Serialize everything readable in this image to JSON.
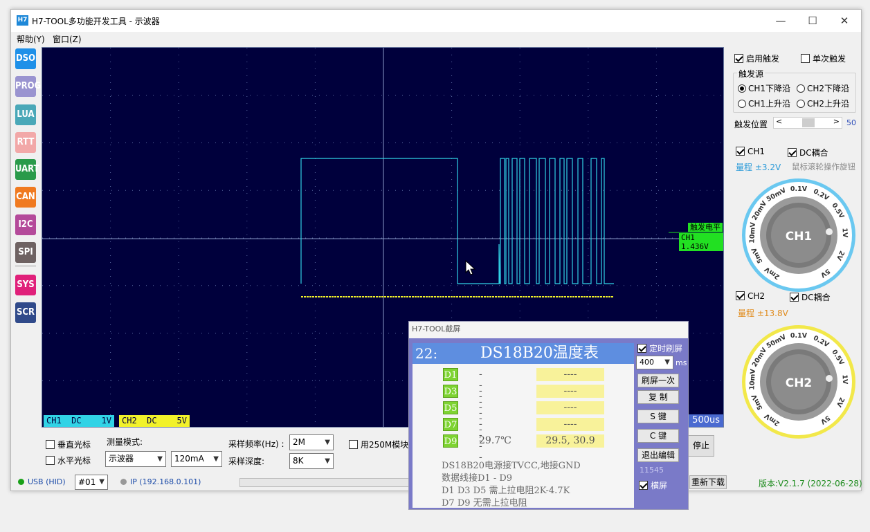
{
  "window": {
    "icon": "H7",
    "title": "H7-TOOL多功能开发工具 - 示波器",
    "minimize": "—",
    "maximize": "☐",
    "close": "✕"
  },
  "menu": {
    "help": "帮助(Y)",
    "window": "窗口(Z)"
  },
  "sidebar": {
    "items": [
      {
        "label": "DSO",
        "color": "#1e90e8"
      },
      {
        "label": "PROG",
        "color": "#9a94d0"
      },
      {
        "label": "LUA",
        "color": "#4aa8b8"
      },
      {
        "label": "RTT",
        "color": "#f2a8a8"
      },
      {
        "label": "UART",
        "color": "#2a9a4a"
      },
      {
        "label": "CAN",
        "color": "#f07a20"
      },
      {
        "label": "I2C",
        "color": "#b44a9a"
      },
      {
        "label": "SPI",
        "color": "#6e6262"
      },
      {
        "label": "SYS",
        "color": "#e0207a"
      },
      {
        "label": "SCR",
        "color": "#304a8a"
      }
    ]
  },
  "scope": {
    "trigger_level_label": "触发电平",
    "trigger_value_label": "CH1 1.436V",
    "ch1_label": "CH1  DC    1V",
    "ch2_label": "CH2  DC    5V",
    "timebase": "500us",
    "colors": {
      "ch1": "#31d3e6",
      "ch2": "#f2f22a",
      "bg": "#00003c",
      "trigger": "#22e022"
    }
  },
  "bottom": {
    "vertical_cursor": "垂直光标",
    "horizontal_cursor": "水平光标",
    "measure_mode_label": "测量模式:",
    "measure_mode_value": "示波器",
    "current_range_value": "120mA",
    "sample_rate_label": "采样频率(Hz)  :",
    "sample_rate_value": "2M",
    "sample_depth_label": "采样深度:",
    "sample_depth_value": "8K",
    "use_250m_label": "用250M模块",
    "stop_button": "停止",
    "reload_button": "重新下载"
  },
  "status": {
    "usb": "USB (HID)",
    "device": "#01",
    "ip": "IP (192.168.0.101)",
    "version": "版本:V2.1.7 (2022-06-28)"
  },
  "right_panel": {
    "enable_trigger": "启用触发",
    "single_trigger": "单次触发",
    "trigger_source_title": "触发源",
    "ch1_falling": "CH1下降沿",
    "ch2_falling": "CH2下降沿",
    "ch1_rising": "CH1上升沿",
    "ch2_rising": "CH2上升沿",
    "trigger_position_label": "触发位置",
    "trigger_position_value": "50",
    "trigger_position_fraction": 0.5,
    "ch1": "CH1",
    "ch1_dc": "DC耦合",
    "ch1_range": "量程 ±3.2V",
    "wheel_hint": "鼠标滚轮操作旋钮",
    "ch2": "CH2",
    "ch2_dc": "DC耦合",
    "ch2_range": "量程 ±13.8V",
    "knob1_label": "CH1",
    "knob2_label": "CH2",
    "knob_scale": [
      "2mV",
      "5mV",
      "10mV",
      "20mV",
      "50mV",
      "0.1V",
      "0.2V",
      "0.5V",
      "1V",
      "2V",
      "5V"
    ],
    "colors": {
      "ch1_range": "#2a9ad8",
      "ch2_range": "#e08a1a",
      "knob1_ring": "#6ac8f0",
      "knob2_ring": "#f2e84a"
    }
  },
  "popup": {
    "title": "H7-TOOL截屏",
    "lcd_corner": "22:",
    "lcd_title": "DS18B20温度表",
    "rows": [
      {
        "id": "D1",
        "left": "----",
        "right": "----"
      },
      {
        "id": "D3",
        "left": "----",
        "right": "----"
      },
      {
        "id": "D5",
        "left": "----",
        "right": "----"
      },
      {
        "id": "D7",
        "left": "----",
        "right": "----"
      },
      {
        "id": "D9",
        "left": "29.7℃",
        "right": "29.5, 30.9"
      }
    ],
    "notes": [
      "DS18B20电源接TVCC,地接GND",
      "数据线接D1 - D9",
      "D1 D3 D5 需上拉电阻2K-4.7K",
      "D7 D9 无需上拉电阻"
    ],
    "timed_refresh": "定时刷屏",
    "interval_value": "400",
    "interval_unit": "ms",
    "refresh_once": "刷屏一次",
    "copy": "复 制",
    "s_key": "S 键",
    "c_key": "C 键",
    "exit_edit": "退出编辑",
    "counter": "11545",
    "landscape": "横屏"
  }
}
